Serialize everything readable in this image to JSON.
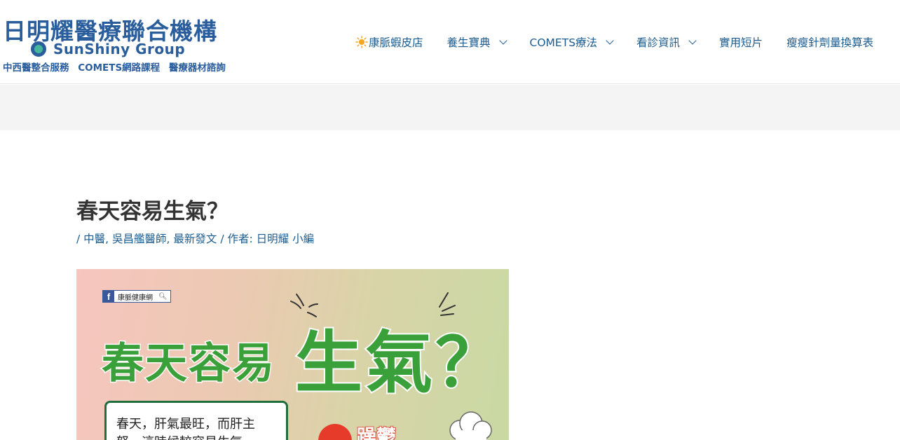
{
  "header": {
    "logo_title": "日明耀醫療聯合機構",
    "logo_brand": "SunShiny Group",
    "logo_sub": "中西醫整合服務  COMETS網路課程  醫療器材諮詢",
    "nav": [
      {
        "label": "康脈蝦皮店",
        "icon": "sun-icon",
        "dropdown": false
      },
      {
        "label": "養生寶典",
        "dropdown": true
      },
      {
        "label": "COMETS療法",
        "dropdown": true
      },
      {
        "label": "看診資訊",
        "dropdown": true
      },
      {
        "label": "實用短片",
        "dropdown": false
      },
      {
        "label": "瘦瘦針劑量換算表",
        "dropdown": false
      }
    ]
  },
  "post": {
    "title": "春天容易生氣？",
    "meta_prefix": "/ ",
    "categories": [
      "中醫",
      "吳昌艦醫師",
      "最新發文"
    ],
    "author_prefix": " / 作者: ",
    "author": "日明耀 小編"
  },
  "featured": {
    "fb_badge": "康脈健康網",
    "headline_small": "春天容易",
    "headline_big": "生氣？",
    "card_text_1": "春天，肝氣最旺，而肝主",
    "card_text_2": "怒，這時候較容易生氣，",
    "angry_word": "躁鬱"
  },
  "colors": {
    "link": "#1d5c8f",
    "logo": "#2a5d9c",
    "headline_green": "#3aa13a"
  }
}
